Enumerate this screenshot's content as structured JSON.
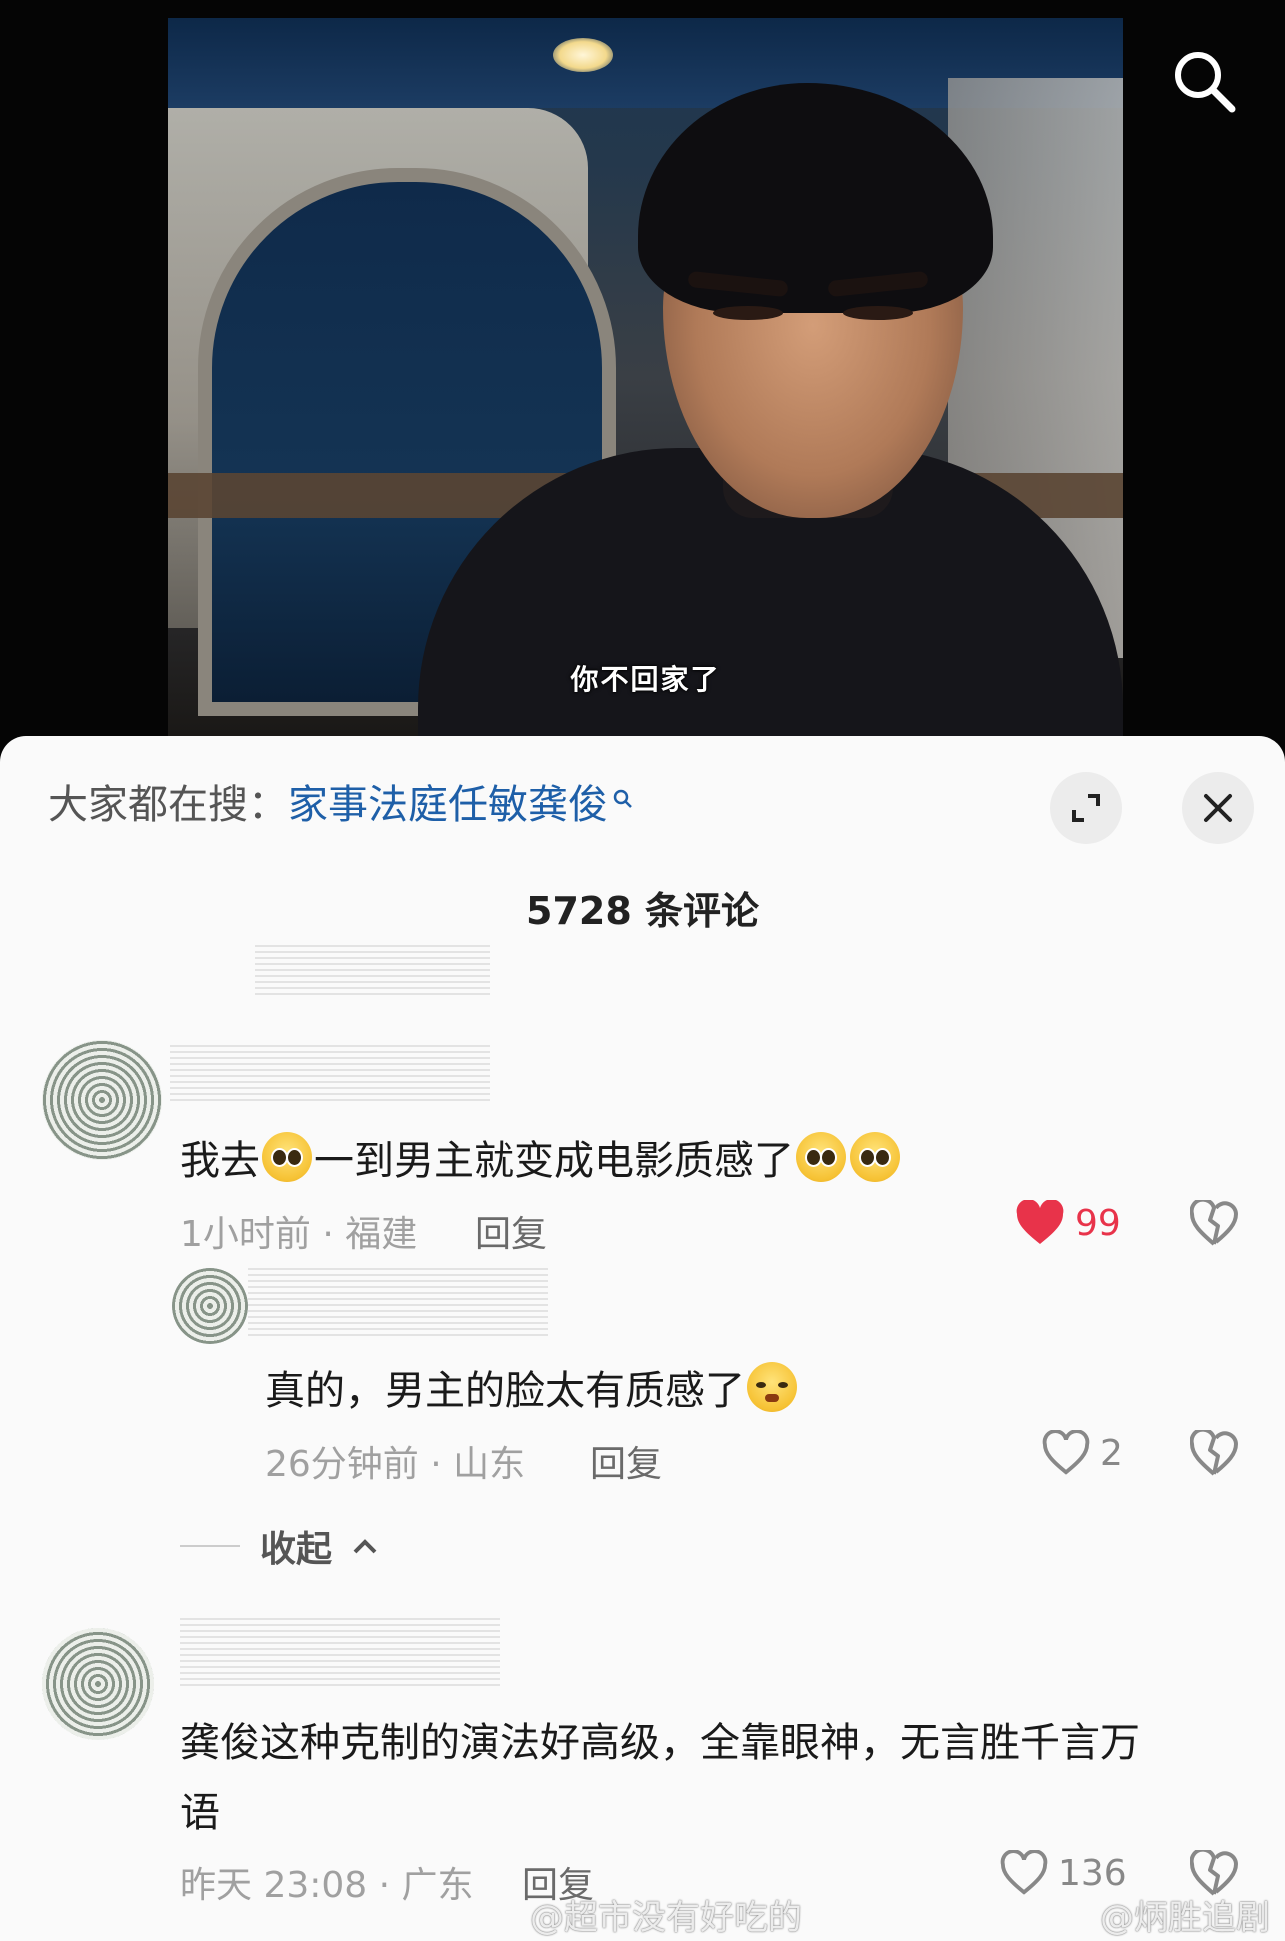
{
  "video": {
    "subtitle": "你不回家了",
    "search_icon": "search-icon"
  },
  "panel": {
    "search_prefix": "大家都在搜：",
    "search_term": "家事法庭任敏龚俊",
    "count_label": "5728 条评论",
    "expand_icon": "expand-icon",
    "close_icon": "close-icon"
  },
  "comments": [
    {
      "text_before": "我去",
      "text_after": "一到男主就变成电影质感了",
      "meta": "1小时前 · 福建",
      "reply": "回复",
      "likes": "99",
      "liked": true
    },
    {
      "text": "真的，男主的脸太有质感了",
      "meta": "26分钟前 · 山东",
      "reply": "回复",
      "likes": "2"
    },
    {
      "text_line1": "龚俊这种克制的演法好高级，全靠眼神，无言胜千言万",
      "text_line2": "语",
      "meta": "昨天 23:08 · 广东",
      "reply": "回复",
      "likes": "136"
    }
  ],
  "collapse_label": "收起",
  "watermarks": [
    "@超市没有好吃的",
    "@炳胜追剧"
  ],
  "colors": {
    "like_red": "#e8334a",
    "link_blue": "#1e5fa8"
  }
}
